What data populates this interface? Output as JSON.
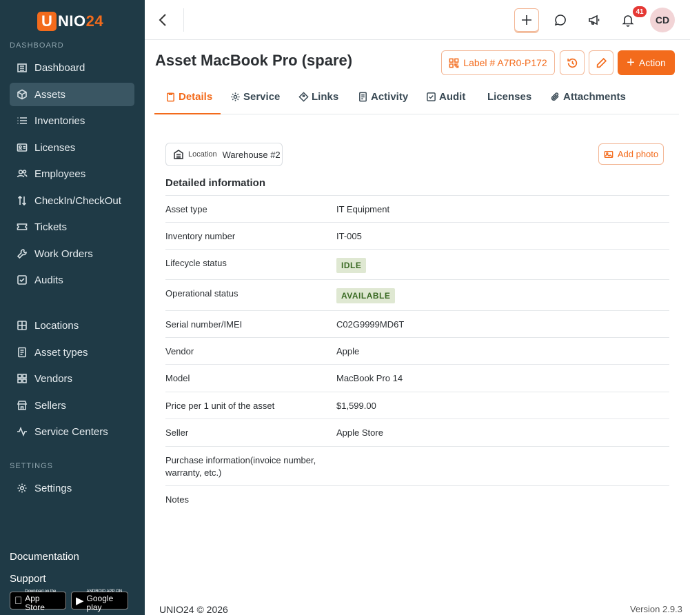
{
  "app": {
    "logo_letter": "U",
    "logo_text": "NIO",
    "logo_number": "24"
  },
  "sidebar": {
    "dashboard_section": "DASHBOARD",
    "items": [
      {
        "label": "Dashboard",
        "icon": "building-icon"
      },
      {
        "label": "Assets",
        "icon": "cube-icon",
        "active": true
      },
      {
        "label": "Inventories",
        "icon": "list-icon"
      },
      {
        "label": "Licenses",
        "icon": "id-card-icon"
      },
      {
        "label": "Employees",
        "icon": "people-icon"
      },
      {
        "label": "CheckIn/CheckOut",
        "icon": "arrows-updown-icon"
      },
      {
        "label": "Tickets",
        "icon": "ticket-icon"
      },
      {
        "label": "Work Orders",
        "icon": "wrench-icon"
      },
      {
        "label": "Audits",
        "icon": "checkbox-icon"
      }
    ],
    "directory_items": [
      {
        "label": "Locations",
        "icon": "grid-icon"
      },
      {
        "label": "Asset types",
        "icon": "document-icon"
      },
      {
        "label": "Vendors",
        "icon": "apps-icon"
      },
      {
        "label": "Sellers",
        "icon": "store-icon"
      },
      {
        "label": "Service Centers",
        "icon": "pulse-icon"
      }
    ],
    "settings_section": "SETTINGS",
    "settings_item": "Settings",
    "documentation": "Documentation",
    "support": "Support",
    "app_store_small": "Download on the",
    "app_store_big": "App Store",
    "google_play_small": "ANDROID APP ON",
    "google_play_big": "Google play"
  },
  "topbar": {
    "notification_count": "41",
    "avatar_initials": "CD"
  },
  "header": {
    "title": "Asset MacBook Pro (spare)",
    "label_button": "Label # A7R0-P172",
    "action_button": "Action"
  },
  "tabs": [
    {
      "label": "Details",
      "icon": "clipboard-icon",
      "active": true
    },
    {
      "label": "Service",
      "icon": "gear-icon"
    },
    {
      "label": "Links",
      "icon": "diamond-icon"
    },
    {
      "label": "Activity",
      "icon": "document-icon"
    },
    {
      "label": "Audit",
      "icon": "checkbox-icon"
    },
    {
      "label": "Licenses",
      "icon": ""
    },
    {
      "label": "Attachments",
      "icon": "paperclip-icon"
    }
  ],
  "location": {
    "label": "Location",
    "value": "Warehouse #2"
  },
  "add_photo": "Add photo",
  "details": {
    "title": "Detailed information",
    "asset_type_label": "Asset type",
    "asset_type": "IT Equipment",
    "inventory_number_label": "Inventory number",
    "inventory_number": "IT-005",
    "lifecycle_status_label": "Lifecycle status",
    "lifecycle_status": "IDLE",
    "operational_status_label": "Operational status",
    "operational_status": "AVAILABLE",
    "serial_label": "Serial number/IMEI",
    "serial": "C02G9999MD6T",
    "vendor_label": "Vendor",
    "vendor": "Apple",
    "model_label": "Model",
    "model": "MacBook Pro 14",
    "price_label": "Price per 1 unit of the asset",
    "price": "$1,599.00",
    "seller_label": "Seller",
    "seller": "Apple Store",
    "purchase_label": "Purchase information(invoice number, warranty, etc.)",
    "purchase": "",
    "notes_label": "Notes",
    "notes": ""
  },
  "footer": {
    "copyright": "UNIO24 © 2026",
    "version": "Version 2.9.3"
  },
  "colors": {
    "accent": "#f36b1c",
    "sidebar_bg": "#1f3a46",
    "sidebar_active": "#3a5663",
    "status_bg": "#dfe8d2",
    "status_text": "#3a6a23"
  }
}
